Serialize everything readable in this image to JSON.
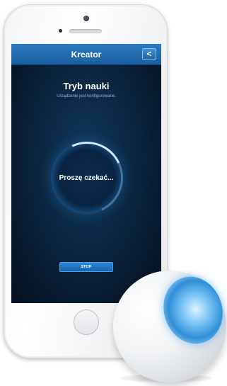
{
  "app": {
    "nav_title": "Kreator",
    "back_icon": "chevron-left-icon",
    "back_glyph": "<"
  },
  "content": {
    "heading": "Tryb nauki",
    "subheading": "Urządzenie jest konfigurowane.",
    "wait_text": "Proszę czekać...",
    "stop_label": "STOP"
  },
  "colors": {
    "accent": "#1f6fb8",
    "screen_background": "#07172a",
    "sensor_glow": "#2f8fd8"
  }
}
